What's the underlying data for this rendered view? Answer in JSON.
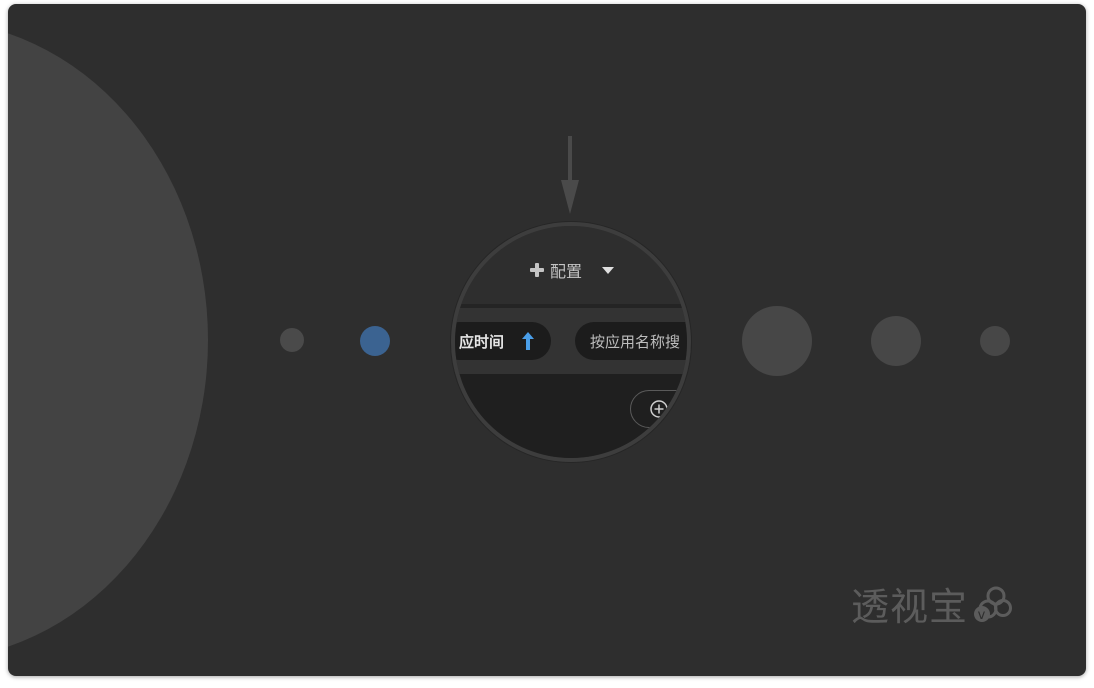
{
  "colors": {
    "background": "#2e2e2e",
    "accent_blue": "#3b6391",
    "sort_arrow_blue": "#4a9ee8"
  },
  "magnifier": {
    "config_label": "配置",
    "sort_label": "应时间",
    "search_placeholder": "按应用名称搜"
  },
  "watermark": {
    "text": "透视宝",
    "badge_letter": "v"
  },
  "icons": [
    "arrow-down-icon",
    "plus-icon",
    "caret-down-icon",
    "arrow-up-icon",
    "add-circle-icon",
    "cloud-v-logo-icon"
  ]
}
